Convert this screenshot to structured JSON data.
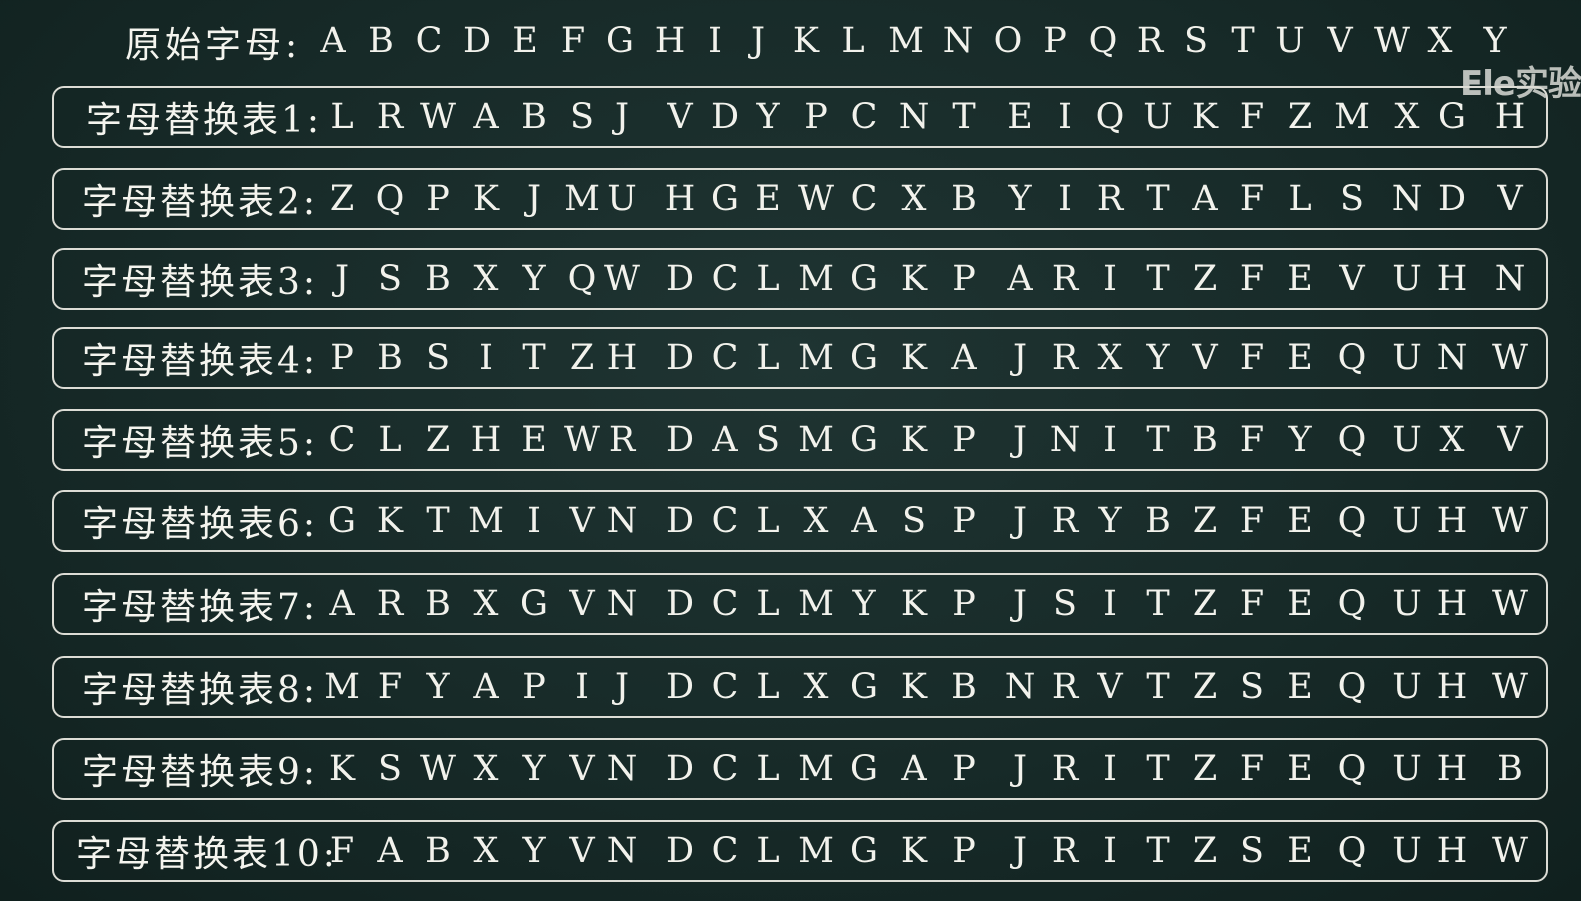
{
  "header": {
    "label": "原始字母:",
    "letters": [
      "A",
      "B",
      "C",
      "D",
      "E",
      "F",
      "G",
      "H",
      "I",
      "J",
      "K",
      "L",
      "M",
      "N",
      "O",
      "P",
      "Q",
      "R",
      "S",
      "T",
      "U",
      "V",
      "W",
      "X",
      "Y"
    ]
  },
  "watermark": "Ele实验",
  "tables": [
    {
      "label": "字母替换表1:",
      "letters": [
        "L",
        "R",
        "W",
        "A",
        "B",
        "S",
        "J",
        "V",
        "D",
        "Y",
        "P",
        "C",
        "N",
        "T",
        "E",
        "I",
        "Q",
        "U",
        "K",
        "F",
        "Z",
        "M",
        "X",
        "G",
        "H"
      ]
    },
    {
      "label": "字母替换表2:",
      "letters": [
        "Z",
        "Q",
        "P",
        "K",
        "J",
        "M",
        "U",
        "H",
        "G",
        "E",
        "W",
        "C",
        "X",
        "B",
        "Y",
        "I",
        "R",
        "T",
        "A",
        "F",
        "L",
        "S",
        "N",
        "D",
        "V"
      ]
    },
    {
      "label": "字母替换表3:",
      "letters": [
        "J",
        "S",
        "B",
        "X",
        "Y",
        "Q",
        "W",
        "D",
        "C",
        "L",
        "M",
        "G",
        "K",
        "P",
        "A",
        "R",
        "I",
        "T",
        "Z",
        "F",
        "E",
        "V",
        "U",
        "H",
        "N"
      ]
    },
    {
      "label": "字母替换表4:",
      "letters": [
        "P",
        "B",
        "S",
        "I",
        "T",
        "Z",
        "H",
        "D",
        "C",
        "L",
        "M",
        "G",
        "K",
        "A",
        "J",
        "R",
        "X",
        "Y",
        "V",
        "F",
        "E",
        "Q",
        "U",
        "N",
        "W"
      ]
    },
    {
      "label": "字母替换表5:",
      "letters": [
        "C",
        "L",
        "Z",
        "H",
        "E",
        "W",
        "R",
        "D",
        "A",
        "S",
        "M",
        "G",
        "K",
        "P",
        "J",
        "N",
        "I",
        "T",
        "B",
        "F",
        "Y",
        "Q",
        "U",
        "X",
        "V"
      ]
    },
    {
      "label": "字母替换表6:",
      "letters": [
        "G",
        "K",
        "T",
        "M",
        "I",
        "V",
        "N",
        "D",
        "C",
        "L",
        "X",
        "A",
        "S",
        "P",
        "J",
        "R",
        "Y",
        "B",
        "Z",
        "F",
        "E",
        "Q",
        "U",
        "H",
        "W"
      ]
    },
    {
      "label": "字母替换表7:",
      "letters": [
        "A",
        "R",
        "B",
        "X",
        "G",
        "V",
        "N",
        "D",
        "C",
        "L",
        "M",
        "Y",
        "K",
        "P",
        "J",
        "S",
        "I",
        "T",
        "Z",
        "F",
        "E",
        "Q",
        "U",
        "H",
        "W"
      ]
    },
    {
      "label": "字母替换表8:",
      "letters": [
        "M",
        "F",
        "Y",
        "A",
        "P",
        "I",
        "J",
        "D",
        "C",
        "L",
        "X",
        "G",
        "K",
        "B",
        "N",
        "R",
        "V",
        "T",
        "Z",
        "S",
        "E",
        "Q",
        "U",
        "H",
        "W"
      ]
    },
    {
      "label": "字母替换表9:",
      "letters": [
        "K",
        "S",
        "W",
        "X",
        "Y",
        "V",
        "N",
        "D",
        "C",
        "L",
        "M",
        "G",
        "A",
        "P",
        "J",
        "R",
        "I",
        "T",
        "Z",
        "F",
        "E",
        "Q",
        "U",
        "H",
        "B"
      ]
    },
    {
      "label": "字母替换表10:",
      "letters": [
        "F",
        "A",
        "B",
        "X",
        "Y",
        "V",
        "N",
        "D",
        "C",
        "L",
        "M",
        "G",
        "K",
        "P",
        "J",
        "R",
        "I",
        "T",
        "Z",
        "S",
        "E",
        "Q",
        "U",
        "H",
        "W"
      ]
    }
  ]
}
